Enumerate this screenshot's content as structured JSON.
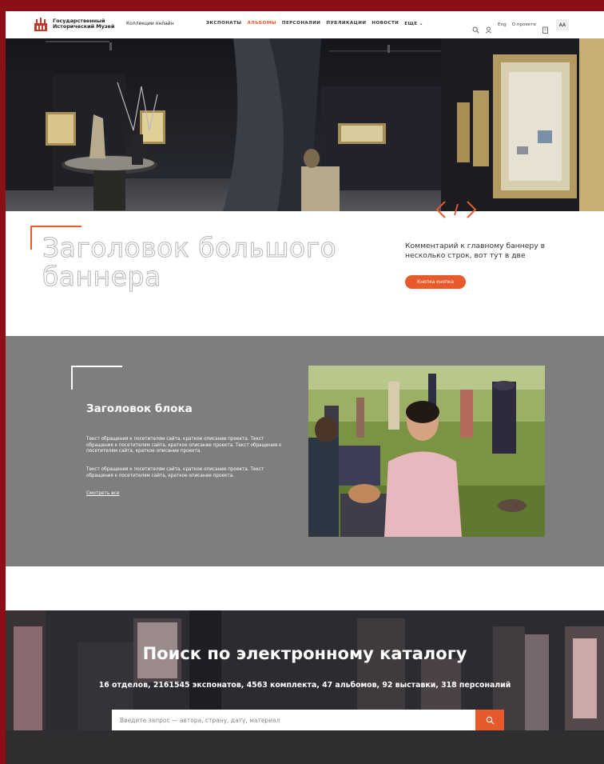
{
  "header": {
    "logo_line1": "Государственный",
    "logo_line2": "Исторический Музей",
    "collections": "Коллекции онлайн",
    "nav": [
      {
        "label": "ЭКСПОНАТЫ",
        "active": false
      },
      {
        "label": "АЛЬБОМЫ",
        "active": true
      },
      {
        "label": "ПЕРСОНАЛИИ",
        "active": false
      },
      {
        "label": "ПУБЛИКАЦИИ",
        "active": false
      },
      {
        "label": "НОВОСТИ",
        "active": false
      },
      {
        "label": "ЕЩЕ",
        "active": false
      }
    ],
    "lang": "Eng",
    "about": "О проекте",
    "font_size_toggle": "AA",
    "icons": [
      "search-icon",
      "user-icon",
      "building-icon"
    ]
  },
  "hero": {
    "arrows": [
      "prev-arrow-icon",
      "next-arrow-icon"
    ]
  },
  "banner": {
    "title": "Заголовок большого баннера",
    "comment": "Комментарий к главному баннеру в несколько строк, вот тут в две",
    "button": "Кнопка кнопка"
  },
  "block": {
    "title": "Заголовок блока",
    "p1": "Текст обращения к посетителям сайта, краткое описание проекта. Текст обращения к посетителям сайта, краткое описание проекта. Текст обращения к посетителям сайта, краткое описание проекта.",
    "p2": "Текст обращения к посетителям сайта, краткое описание проекта. Текст обращения к посетителям сайта, краткое описание проекта.",
    "link": "Смотреть все"
  },
  "search": {
    "title": "Поиск по электронному каталогу",
    "stats": "16 отделов, 2161545 экспонатов, 4563 комплекта, 47 альбомов, 92 выставки, 318 персоналий",
    "placeholder": "Введите запрос — автора, страну, дату, материал"
  },
  "colors": {
    "accent": "#e65a2b",
    "frame_bg": "#8b0f14",
    "block_bg": "#7e7e7e"
  }
}
